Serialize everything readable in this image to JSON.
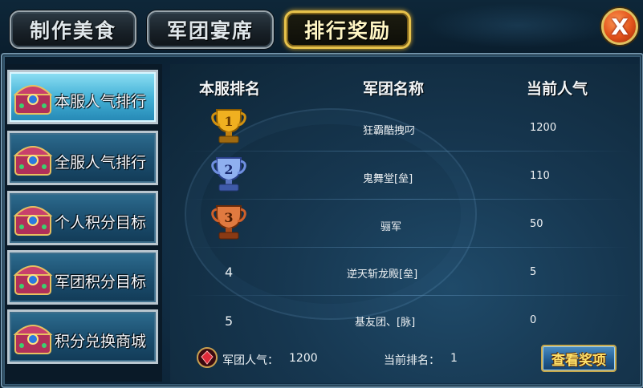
{
  "tabs": [
    {
      "label": "制作美食",
      "active": false
    },
    {
      "label": "军团宴席",
      "active": false
    },
    {
      "label": "排行奖励",
      "active": true
    }
  ],
  "close_glyph": "X",
  "sidebar": {
    "items": [
      {
        "label": "本服人气排行",
        "active": true,
        "icon": "treasure-chest-icon"
      },
      {
        "label": "全服人气排行",
        "active": false,
        "icon": "treasure-chest-icon"
      },
      {
        "label": "个人积分目标",
        "active": false,
        "icon": "treasure-chest-icon"
      },
      {
        "label": "军团积分目标",
        "active": false,
        "icon": "treasure-chest-icon"
      },
      {
        "label": "积分兑换商城",
        "active": false,
        "icon": "treasure-chest-icon"
      }
    ]
  },
  "table": {
    "headers": {
      "rank": "本服排名",
      "name": "军团名称",
      "popularity": "当前人气"
    },
    "rows": [
      {
        "rank": "1",
        "rank_icon": "gold-trophy-icon",
        "name": "狂霸酷拽叼",
        "popularity": "1200"
      },
      {
        "rank": "2",
        "rank_icon": "silver-trophy-icon",
        "name": "鬼舞堂[垒]",
        "popularity": "110"
      },
      {
        "rank": "3",
        "rank_icon": "bronze-trophy-icon",
        "name": "骊军",
        "popularity": "50"
      },
      {
        "rank": "4",
        "rank_icon": "",
        "name": "逆天斩龙殿[垒]",
        "popularity": "5"
      },
      {
        "rank": "5",
        "rank_icon": "",
        "name": "基友团、[脉]",
        "popularity": "0"
      }
    ]
  },
  "footer": {
    "popularity_label": "军团人气：",
    "popularity_value": "1200",
    "current_rank_label": "当前排名：",
    "current_rank_value": "1",
    "view_rewards_label": "查看奖项"
  },
  "colors": {
    "active_tab_border": "#e7c24b",
    "gold": "#f0b020",
    "silver": "#6f8fe0",
    "bronze": "#d0602a",
    "button_text": "#ffe16a"
  }
}
